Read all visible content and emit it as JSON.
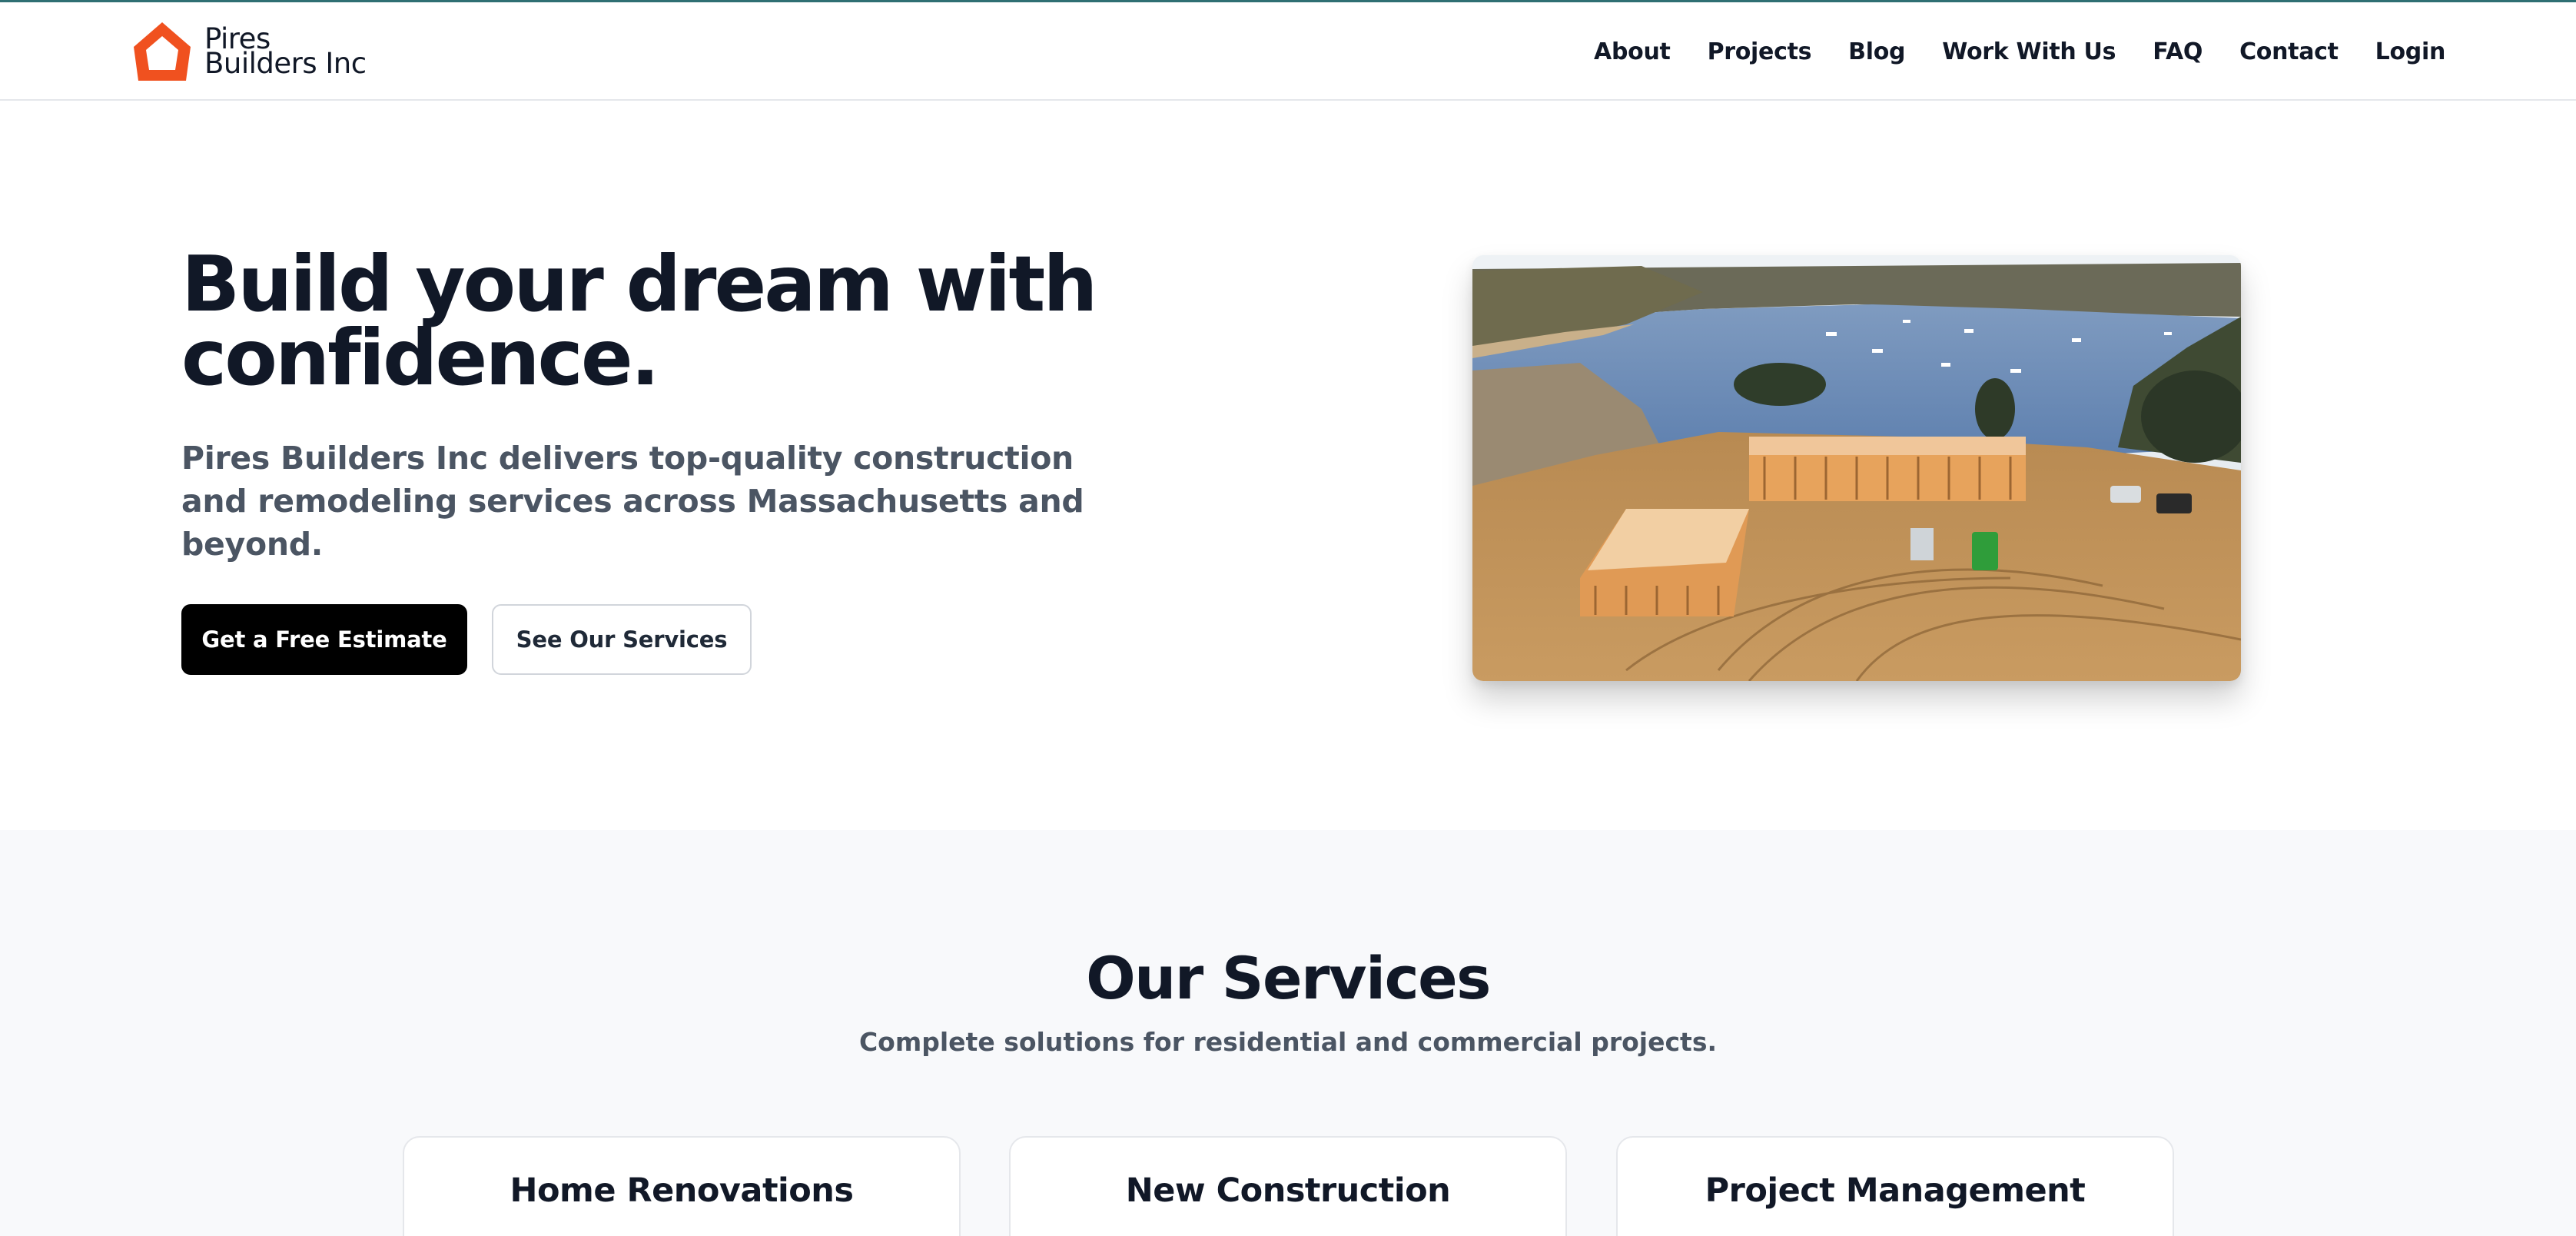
{
  "brand": {
    "name_line1": "Pires",
    "name_line2": "Builders Inc",
    "logo_icon": "house-icon",
    "accent_color": "#f0511f"
  },
  "nav": {
    "items": [
      {
        "label": "About"
      },
      {
        "label": "Projects"
      },
      {
        "label": "Blog"
      },
      {
        "label": "Work With Us"
      },
      {
        "label": "FAQ"
      },
      {
        "label": "Contact"
      },
      {
        "label": "Login"
      }
    ]
  },
  "hero": {
    "title": "Build your dream with confidence.",
    "subtitle": "Pires Builders Inc delivers top-quality construction and remodeling services across Massachusetts and beyond.",
    "primary_cta": "Get a Free Estimate",
    "secondary_cta": "See Our Services",
    "image_alt": "Aerial view of a house under construction beside a harbor"
  },
  "services": {
    "title": "Our Services",
    "subtitle": "Complete solutions for residential and commercial projects.",
    "cards": [
      {
        "title": "Home Renovations"
      },
      {
        "title": "New Construction"
      },
      {
        "title": "Project Management"
      }
    ]
  }
}
